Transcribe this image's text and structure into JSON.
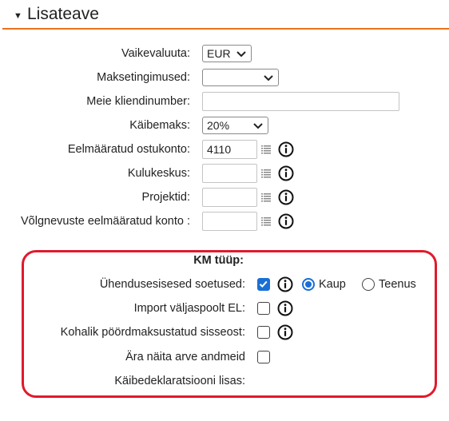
{
  "section": {
    "title": "Lisateave"
  },
  "form": {
    "default_currency": {
      "label": "Vaikevaluuta:",
      "value": "EUR"
    },
    "payment_terms": {
      "label": "Maksetingimused:",
      "value": ""
    },
    "our_client_number": {
      "label": "Meie kliendinumber:",
      "value": ""
    },
    "vat": {
      "label": "Käibemaks:",
      "value": "20%"
    },
    "purchase_account": {
      "label": "Eelmääratud ostukonto:",
      "value": "4110"
    },
    "cost_center": {
      "label": "Kulukeskus:",
      "value": ""
    },
    "projects": {
      "label": "Projektid:",
      "value": ""
    },
    "debt_account": {
      "label": "Võlgnevuste eelmääratud konto :",
      "value": ""
    }
  },
  "km": {
    "title": "KM tüüp:",
    "intra_union": {
      "label": "Ühendusesisesed soetused:",
      "checked": true,
      "options": [
        "Kaup",
        "Teenus"
      ],
      "selected": "Kaup"
    },
    "import_outside_eu": {
      "label": "Import väljaspoolt EL:",
      "checked": false
    },
    "local_reverse_charge": {
      "label": "Kohalik pöördmaksustatud sisseost:",
      "checked": false
    },
    "hide_invoice_data": {
      "label": "Ära näita arve andmeid",
      "checked": false
    },
    "vat_return_annex": {
      "label": "Käibedeklaratsiooni lisas:"
    }
  },
  "colors": {
    "accent_rule": "#e8731c",
    "highlight_box": "#e01a2c",
    "checkbox_blue": "#1a6fd6"
  },
  "icons": {
    "collapse": "triangle-down-icon",
    "list": "list-icon",
    "info": "info-circle-icon",
    "dropdown": "chevron-down-icon"
  }
}
